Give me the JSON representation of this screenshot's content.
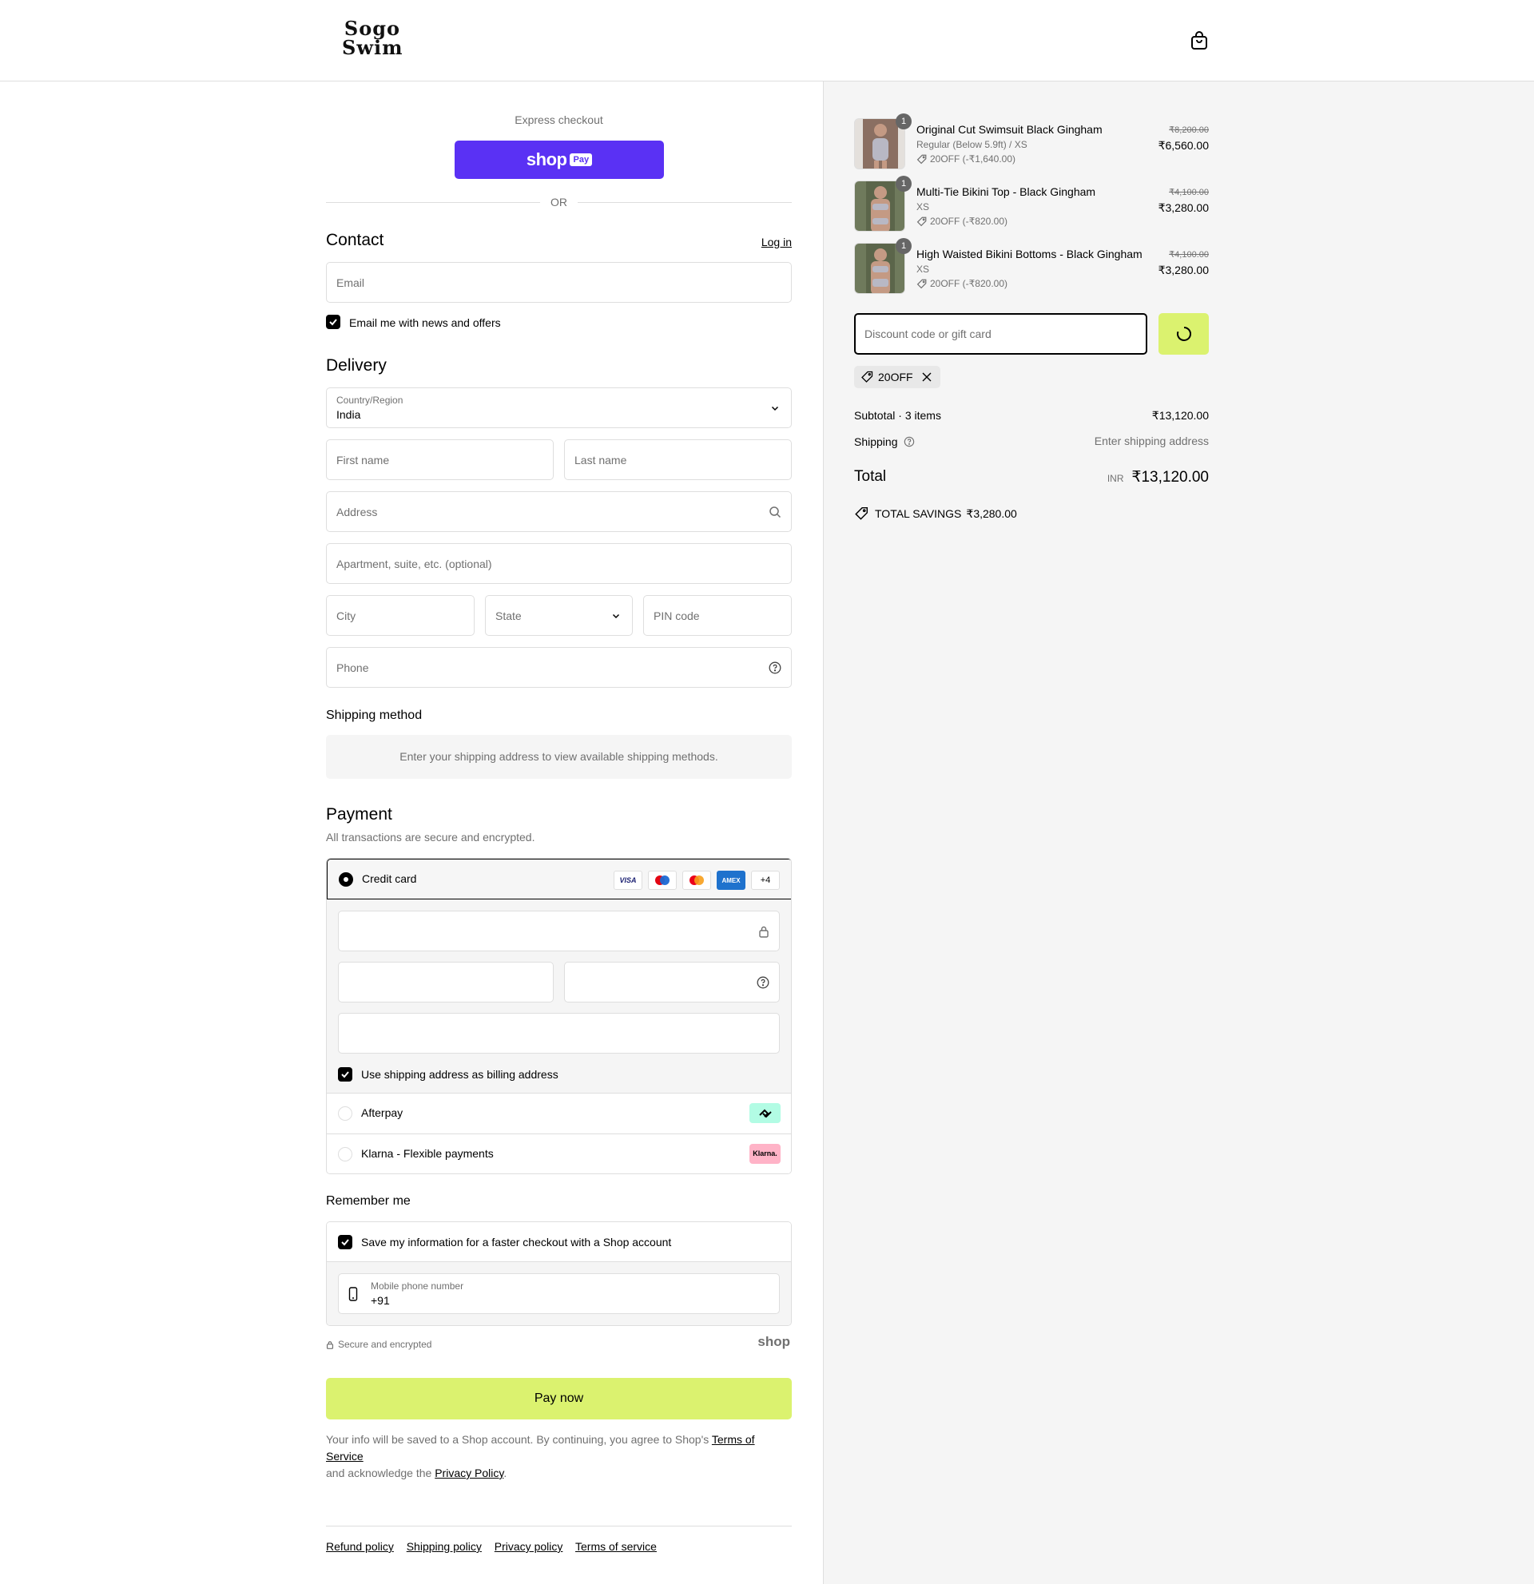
{
  "header": {
    "logo_line1": "Sogo",
    "logo_line2": "Swim"
  },
  "express": {
    "label": "Express checkout",
    "shop_text": "shop",
    "pay_text": "Pay",
    "or_text": "OR"
  },
  "contact": {
    "title": "Contact",
    "login_link": "Log in",
    "email_placeholder": "Email",
    "newsletter_label": "Email me with news and offers",
    "newsletter_checked": true
  },
  "delivery": {
    "title": "Delivery",
    "country_label": "Country/Region",
    "country_value": "India",
    "first_name_placeholder": "First name",
    "last_name_placeholder": "Last name",
    "address_placeholder": "Address",
    "apartment_placeholder": "Apartment, suite, etc. (optional)",
    "city_placeholder": "City",
    "state_placeholder": "State",
    "pin_placeholder": "PIN code",
    "phone_placeholder": "Phone"
  },
  "shipping_method": {
    "title": "Shipping method",
    "message": "Enter your shipping address to view available shipping methods."
  },
  "payment": {
    "title": "Payment",
    "subtitle": "All transactions are secure and encrypted.",
    "credit_card_label": "Credit card",
    "card_logos": [
      "VISA",
      "Maestro",
      "Mastercard",
      "AMEX"
    ],
    "more_cards": "+4",
    "billing_label": "Use shipping address as billing address",
    "afterpay_label": "Afterpay",
    "klarna_label": "Klarna - Flexible payments",
    "klarna_badge": "Klarna."
  },
  "remember": {
    "title": "Remember me",
    "save_label": "Save my information for a faster checkout with a Shop account",
    "phone_label": "Mobile phone number",
    "phone_value": "+91",
    "secure_text": "Secure and encrypted",
    "shop_brand": "shop"
  },
  "pay_now": "Pay now",
  "fine_print": {
    "part1": "Your info will be saved to a Shop account. By continuing, you agree to Shop's ",
    "terms": "Terms of Service",
    "part2": "and acknowledge the ",
    "privacy": "Privacy Policy",
    "part3": "."
  },
  "footer": {
    "links": [
      "Refund policy",
      "Shipping policy",
      "Privacy policy",
      "Terms of service"
    ]
  },
  "summary": {
    "items": [
      {
        "name": "Original Cut Swimsuit Black Gingham",
        "variant": "Regular (Below 5.9ft) / XS",
        "discount": "20OFF (-₹1,640.00)",
        "old_price": "₹8,200.00",
        "price": "₹6,560.00",
        "qty": "1"
      },
      {
        "name": "Multi-Tie Bikini Top - Black Gingham",
        "variant": "XS",
        "discount": "20OFF (-₹820.00)",
        "old_price": "₹4,100.00",
        "price": "₹3,280.00",
        "qty": "1"
      },
      {
        "name": "High Waisted Bikini Bottoms - Black Gingham",
        "variant": "XS",
        "discount": "20OFF (-₹820.00)",
        "old_price": "₹4,100.00",
        "price": "₹3,280.00",
        "qty": "1"
      }
    ],
    "discount_placeholder": "Discount code or gift card",
    "applied_code": "20OFF",
    "subtotal_label": "Subtotal · 3 items",
    "subtotal_value": "₹13,120.00",
    "shipping_label": "Shipping",
    "shipping_value": "Enter shipping address",
    "total_label": "Total",
    "total_currency": "INR",
    "total_value": "₹13,120.00",
    "savings_label": "TOTAL SAVINGS",
    "savings_value": "₹3,280.00"
  },
  "colors": {
    "accent": "#dbf26f",
    "shoppay": "#5a31f4",
    "border": "#dedede",
    "muted": "#707070",
    "panel": "#f5f5f5"
  }
}
